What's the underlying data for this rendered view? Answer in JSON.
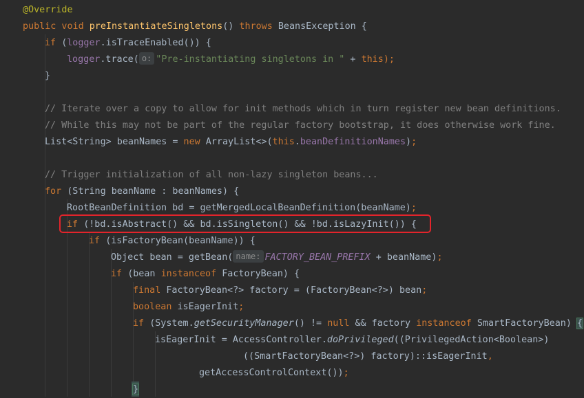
{
  "lines": [
    {
      "segments": [
        {
          "cls": "ann",
          "text": "@Override"
        }
      ]
    },
    {
      "segments": [
        {
          "cls": "kw",
          "text": "public void "
        },
        {
          "cls": "fn",
          "text": "preInstantiateSingletons"
        },
        {
          "cls": "",
          "text": "() "
        },
        {
          "cls": "kw",
          "text": "throws "
        },
        {
          "cls": "",
          "text": "BeansException {"
        }
      ]
    },
    {
      "segments": [
        {
          "cls": "kw",
          "text": "if "
        },
        {
          "cls": "",
          "text": "("
        },
        {
          "cls": "field",
          "text": "logger"
        },
        {
          "cls": "",
          "text": ".isTraceEnabled()) {"
        }
      ]
    },
    {
      "segments": [
        {
          "cls": "field",
          "text": "logger"
        },
        {
          "cls": "",
          "text": ".trace("
        },
        {
          "cls": "hint",
          "text": "o:"
        },
        {
          "cls": "str",
          "text": "\"Pre-instantiating singletons in \""
        },
        {
          "cls": "",
          "text": " + "
        },
        {
          "cls": "kw",
          "text": "this"
        },
        {
          "cls": "punct",
          "text": ");"
        }
      ]
    },
    {
      "segments": [
        {
          "cls": "",
          "text": "}"
        }
      ]
    },
    {
      "segments": []
    },
    {
      "segments": [
        {
          "cls": "cmt",
          "text": "// Iterate over a copy to allow for init methods which in turn register new bean definitions."
        }
      ]
    },
    {
      "segments": [
        {
          "cls": "cmt",
          "text": "// While this may not be part of the regular factory bootstrap, it does otherwise work fine."
        }
      ]
    },
    {
      "segments": [
        {
          "cls": "",
          "text": "List<String> beanNames = "
        },
        {
          "cls": "kw",
          "text": "new "
        },
        {
          "cls": "",
          "text": "ArrayList<>("
        },
        {
          "cls": "kw",
          "text": "this"
        },
        {
          "cls": "",
          "text": "."
        },
        {
          "cls": "field",
          "text": "beanDefinitionNames"
        },
        {
          "cls": "",
          "text": ")"
        },
        {
          "cls": "punct",
          "text": ";"
        }
      ]
    },
    {
      "segments": []
    },
    {
      "segments": [
        {
          "cls": "cmt",
          "text": "// Trigger initialization of all non-lazy singleton beans..."
        }
      ]
    },
    {
      "segments": [
        {
          "cls": "kw",
          "text": "for "
        },
        {
          "cls": "",
          "text": "(String beanName : beanNames) {"
        }
      ]
    },
    {
      "segments": [
        {
          "cls": "",
          "text": "RootBeanDefinition bd = getMergedLocalBeanDefinition(beanName)"
        },
        {
          "cls": "punct",
          "text": ";"
        }
      ]
    },
    {
      "segments": [
        {
          "cls": "kw",
          "text": "if "
        },
        {
          "cls": "",
          "text": "(!bd.isAbstract() && bd.isSingleton() && !bd.isLazyInit()) {"
        }
      ]
    },
    {
      "segments": [
        {
          "cls": "kw",
          "text": "if "
        },
        {
          "cls": "",
          "text": "(isFactoryBean(beanName)) {"
        }
      ]
    },
    {
      "segments": [
        {
          "cls": "",
          "text": "Object bean = getBean("
        },
        {
          "cls": "hint",
          "text": "name:"
        },
        {
          "cls": "cst",
          "text": "FACTORY_BEAN_PREFIX"
        },
        {
          "cls": "",
          "text": " + beanName)"
        },
        {
          "cls": "punct",
          "text": ";"
        }
      ]
    },
    {
      "segments": [
        {
          "cls": "kw",
          "text": "if "
        },
        {
          "cls": "",
          "text": "(bean "
        },
        {
          "cls": "kw",
          "text": "instanceof "
        },
        {
          "cls": "",
          "text": "FactoryBean) {"
        }
      ]
    },
    {
      "segments": [
        {
          "cls": "kw",
          "text": "final "
        },
        {
          "cls": "",
          "text": "FactoryBean<?> factory = (FactoryBean<?>) bean"
        },
        {
          "cls": "punct",
          "text": ";"
        }
      ]
    },
    {
      "segments": [
        {
          "cls": "kw",
          "text": "boolean "
        },
        {
          "cls": "",
          "text": "isEagerInit"
        },
        {
          "cls": "punct",
          "text": ";"
        }
      ]
    },
    {
      "segments": [
        {
          "cls": "kw",
          "text": "if "
        },
        {
          "cls": "",
          "text": "(System."
        },
        {
          "cls": "ital",
          "text": "getSecurityManager"
        },
        {
          "cls": "",
          "text": "() != "
        },
        {
          "cls": "kw",
          "text": "null "
        },
        {
          "cls": "",
          "text": "&& factory "
        },
        {
          "cls": "kw",
          "text": "instanceof "
        },
        {
          "cls": "",
          "text": "SmartFactoryBean) "
        },
        {
          "cls": "brace-match",
          "text": "{"
        }
      ]
    },
    {
      "segments": [
        {
          "cls": "",
          "text": "isEagerInit = AccessController."
        },
        {
          "cls": "ital",
          "text": "doPrivileged"
        },
        {
          "cls": "",
          "text": "((PrivilegedAction<Boolean>)"
        }
      ]
    },
    {
      "segments": [
        {
          "cls": "",
          "text": "((SmartFactoryBean<?>) factory)::isEagerInit"
        },
        {
          "cls": "punct",
          "text": ","
        }
      ]
    },
    {
      "segments": [
        {
          "cls": "",
          "text": "getAccessControlContext())"
        },
        {
          "cls": "punct",
          "text": ";"
        }
      ]
    },
    {
      "segments": [
        {
          "cls": "brace-match",
          "text": "}"
        }
      ]
    }
  ]
}
